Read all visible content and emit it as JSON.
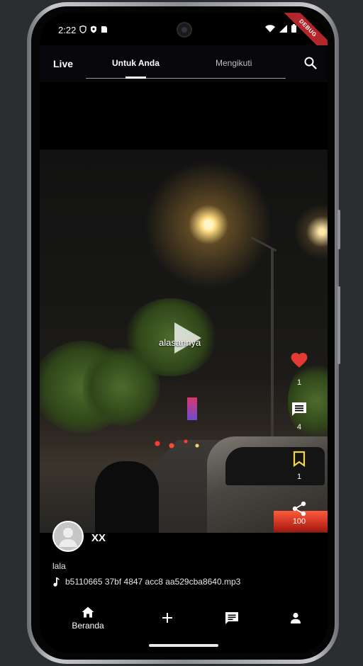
{
  "status_bar": {
    "time": "2:22",
    "debug_ribbon": "DEBUG"
  },
  "top_nav": {
    "live_label": "Live",
    "tabs": [
      {
        "label": "Untuk Anda",
        "active": true
      },
      {
        "label": "Mengikuti",
        "active": false
      }
    ]
  },
  "video": {
    "overlay_text": "alasannya"
  },
  "actions": {
    "likes": "1",
    "comments": "4",
    "saves": "1",
    "shares": "100"
  },
  "post": {
    "author": "XX",
    "caption": "lala",
    "music": "b5110665 37bf 4847 acc8 aa529cba8640.mp3"
  },
  "bottom_nav": {
    "home_label": "Beranda"
  },
  "colors": {
    "like": "#e53935",
    "save": "#f2d54a",
    "background": "#000000"
  }
}
